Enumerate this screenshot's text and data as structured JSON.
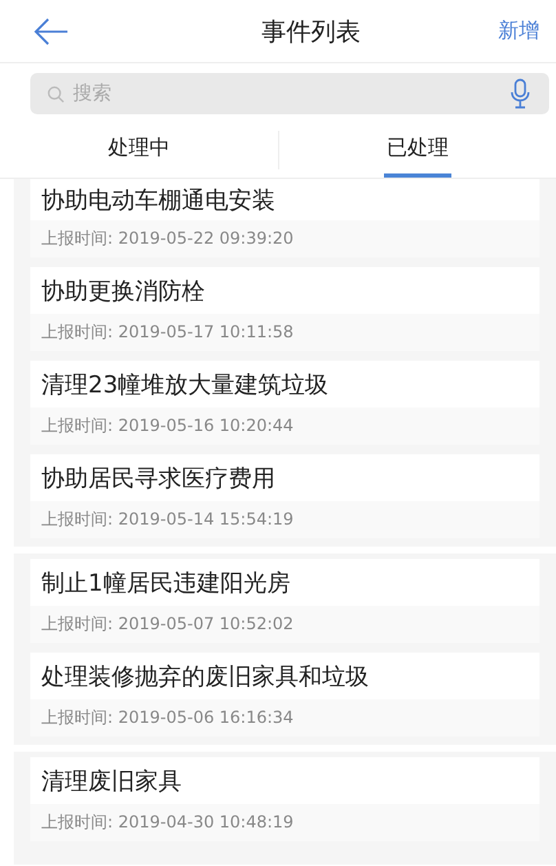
{
  "header": {
    "title": "事件列表",
    "action": "新增"
  },
  "search": {
    "placeholder": "搜索"
  },
  "tabs": [
    {
      "label": "处理中",
      "selected": false
    },
    {
      "label": "已处理",
      "selected": true
    }
  ],
  "groups": [
    {
      "events": [
        {
          "title": "协助电动车棚通电安装",
          "time": "上报时间: 2019-05-22 09:39:20"
        },
        {
          "title": "协助更换消防栓",
          "time": "上报时间: 2019-05-17 10:11:58"
        },
        {
          "title": "清理23幢堆放大量建筑垃圾",
          "time": "上报时间: 2019-05-16 10:20:44"
        },
        {
          "title": "协助居民寻求医疗费用",
          "time": "上报时间: 2019-05-14 15:54:19"
        }
      ]
    },
    {
      "events": [
        {
          "title": "制止1幢居民违建阳光房",
          "time": "上报时间: 2019-05-07 10:52:02"
        },
        {
          "title": "处理装修抛弃的废旧家具和垃圾",
          "time": "上报时间: 2019-05-06 16:16:34"
        }
      ]
    },
    {
      "events": [
        {
          "title": "清理废旧家具",
          "time": "上报时间: 2019-04-30 10:48:19"
        }
      ]
    }
  ]
}
